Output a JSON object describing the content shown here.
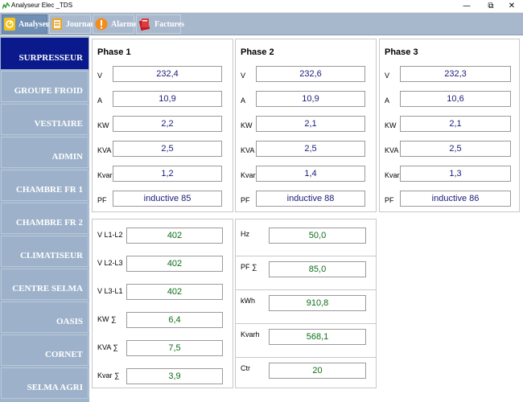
{
  "window": {
    "title": "Analyseur Elec _TDS",
    "minimize": "—",
    "maximize": "⧉",
    "close": "✕"
  },
  "toolbar": [
    {
      "label": "Analyseurs",
      "icon": "gauge-icon",
      "active": true
    },
    {
      "label": "Journaux",
      "icon": "journal-icon",
      "active": false
    },
    {
      "label": "Alarmes",
      "icon": "alarm-icon",
      "active": false
    },
    {
      "label": "Factures",
      "icon": "invoice-icon",
      "active": false
    }
  ],
  "sidebar": [
    {
      "label": "SURPRESSEUR",
      "active": true
    },
    {
      "label": "GROUPE FROID",
      "active": false
    },
    {
      "label": "VESTIAIRE",
      "active": false
    },
    {
      "label": "ADMIN",
      "active": false
    },
    {
      "label": "CHAMBRE FR 1",
      "active": false
    },
    {
      "label": "CHAMBRE FR 2",
      "active": false
    },
    {
      "label": "CLIMATISEUR",
      "active": false
    },
    {
      "label": "CENTRE SELMA",
      "active": false
    },
    {
      "label": "OASIS",
      "active": false
    },
    {
      "label": "CORNET",
      "active": false
    },
    {
      "label": "SELMA AGRI",
      "active": false
    }
  ],
  "phases": [
    {
      "title": "Phase 1",
      "rows": [
        {
          "label": "V",
          "value": "232,4"
        },
        {
          "label": "A",
          "value": "10,9"
        },
        {
          "label": "KW",
          "value": "2,2"
        },
        {
          "label": "KVA",
          "value": "2,5"
        },
        {
          "label": "Kvar",
          "value": "1,2"
        },
        {
          "label": "PF",
          "value": "inductive 85"
        }
      ]
    },
    {
      "title": "Phase 2",
      "rows": [
        {
          "label": "V",
          "value": "232,6"
        },
        {
          "label": "A",
          "value": "10,9"
        },
        {
          "label": "KW",
          "value": "2,1"
        },
        {
          "label": "KVA",
          "value": "2,5"
        },
        {
          "label": "Kvar",
          "value": "1,4"
        },
        {
          "label": "PF",
          "value": "inductive 88"
        }
      ]
    },
    {
      "title": "Phase 3",
      "rows": [
        {
          "label": "V",
          "value": "232,3"
        },
        {
          "label": "A",
          "value": "10,6"
        },
        {
          "label": "KW",
          "value": "2,1"
        },
        {
          "label": "KVA",
          "value": "2,5"
        },
        {
          "label": "Kvar",
          "value": "1,3"
        },
        {
          "label": "PF",
          "value": "inductive 86"
        }
      ]
    }
  ],
  "totals_left": [
    {
      "label": "V L1-L2",
      "value": "402"
    },
    {
      "label": "V L2-L3",
      "value": "402"
    },
    {
      "label": "V L3-L1",
      "value": "402"
    },
    {
      "label": "KW ∑",
      "value": "6,4"
    },
    {
      "label": "KVA ∑",
      "value": "7,5"
    },
    {
      "label": "Kvar ∑",
      "value": "3,9"
    }
  ],
  "totals_right": [
    {
      "label": "Hz",
      "value": "50,0"
    },
    {
      "label": "PF ∑",
      "value": "85,0"
    },
    {
      "label": "kWh",
      "value": "910,8"
    },
    {
      "label": "Kvarh",
      "value": "568,1"
    },
    {
      "label": "Ctr",
      "value": "20"
    }
  ],
  "colors": {
    "toolbar_bg": "#a8b8cc",
    "sidebar_bg": "#9fb3cb",
    "sidebar_active": "#0a1a8c",
    "phase_value": "#1a1a7a",
    "total_value": "#0c6e18"
  }
}
